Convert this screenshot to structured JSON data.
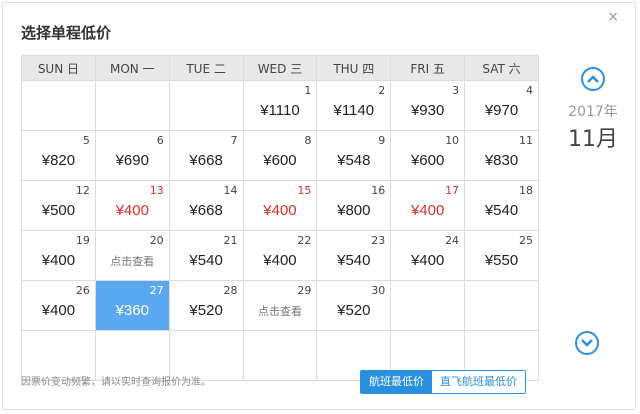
{
  "title": "选择单程低价",
  "close_label": "×",
  "weekdays": [
    "SUN 日",
    "MON 一",
    "TUE 二",
    "WED 三",
    "THU 四",
    "FRI 五",
    "SAT 六"
  ],
  "calendar": {
    "year": "2017年",
    "month": "11月",
    "weeks": [
      [
        null,
        null,
        null,
        {
          "day": "1",
          "price": "¥1110"
        },
        {
          "day": "2",
          "price": "¥1140"
        },
        {
          "day": "3",
          "price": "¥930"
        },
        {
          "day": "4",
          "price": "¥970"
        }
      ],
      [
        {
          "day": "5",
          "price": "¥820"
        },
        {
          "day": "6",
          "price": "¥690"
        },
        {
          "day": "7",
          "price": "¥668"
        },
        {
          "day": "8",
          "price": "¥600"
        },
        {
          "day": "9",
          "price": "¥548"
        },
        {
          "day": "10",
          "price": "¥600"
        },
        {
          "day": "11",
          "price": "¥830"
        }
      ],
      [
        {
          "day": "12",
          "price": "¥500"
        },
        {
          "day": "13",
          "price": "¥400",
          "red": true
        },
        {
          "day": "14",
          "price": "¥668"
        },
        {
          "day": "15",
          "price": "¥400",
          "red": true
        },
        {
          "day": "16",
          "price": "¥800"
        },
        {
          "day": "17",
          "price": "¥400",
          "red": true
        },
        {
          "day": "18",
          "price": "¥540"
        }
      ],
      [
        {
          "day": "19",
          "price": "¥400"
        },
        {
          "day": "20",
          "price": "点击查看",
          "small": true
        },
        {
          "day": "21",
          "price": "¥540"
        },
        {
          "day": "22",
          "price": "¥400"
        },
        {
          "day": "23",
          "price": "¥540"
        },
        {
          "day": "24",
          "price": "¥400"
        },
        {
          "day": "25",
          "price": "¥550"
        }
      ],
      [
        {
          "day": "26",
          "price": "¥400"
        },
        {
          "day": "27",
          "price": "¥360",
          "selected": true
        },
        {
          "day": "28",
          "price": "¥520"
        },
        {
          "day": "29",
          "price": "点击查看",
          "small": true
        },
        {
          "day": "30",
          "price": "¥520"
        },
        null,
        null
      ],
      [
        null,
        null,
        null,
        null,
        null,
        null,
        null
      ]
    ]
  },
  "footer": {
    "note": "因票价变动频繁，请以实时查询报价为准。",
    "toggle_on": "航班最低价",
    "toggle_off": "直飞航班最低价"
  },
  "colors": {
    "accent": "#2b8fe0",
    "selected": "#5aa7f2",
    "highlight": "#d9302b"
  },
  "icons": {
    "prev": "chevron-up-circle-icon",
    "next": "chevron-down-circle-icon"
  }
}
